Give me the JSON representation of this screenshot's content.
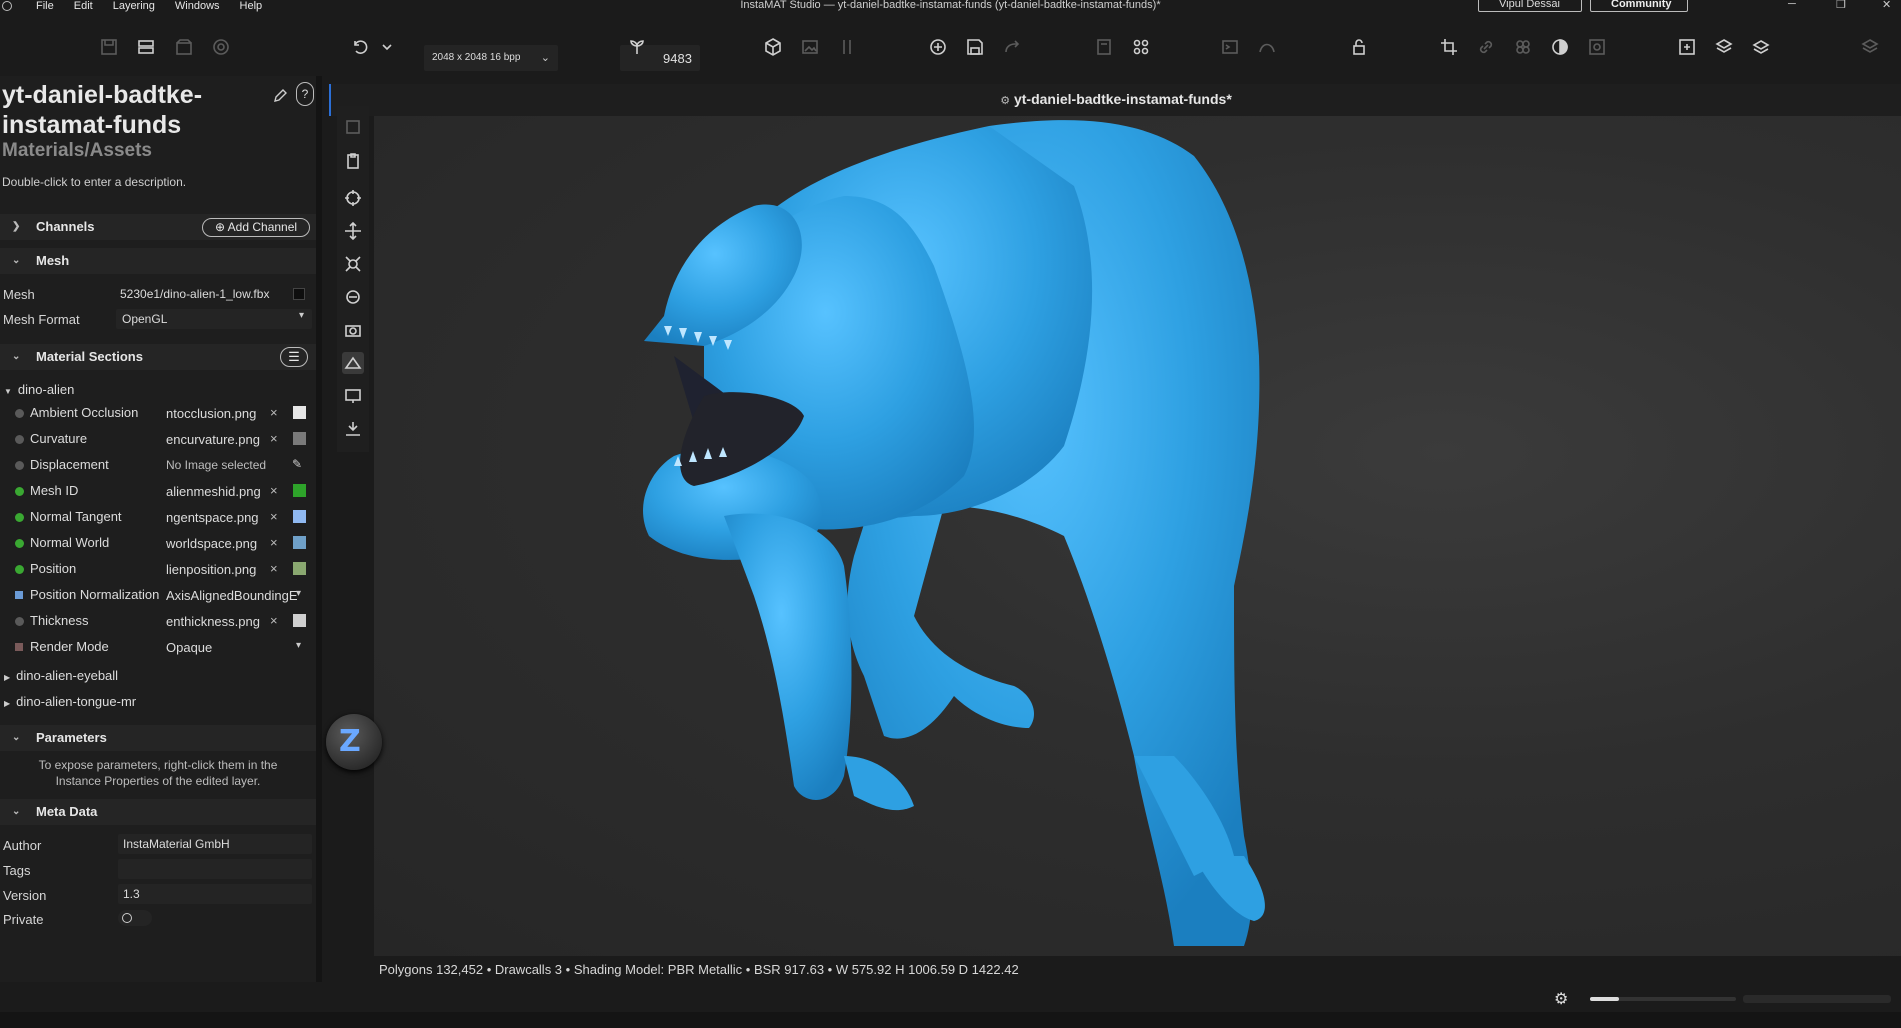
{
  "window": {
    "title": "InstaMAT Studio — yt-daniel-badtke-instamat-funds (yt-daniel-badtke-instamat-funds)*",
    "user_label": "Vipul Dessai",
    "community_label": "Community"
  },
  "menu": [
    "File",
    "Edit",
    "Layering",
    "Windows",
    "Help"
  ],
  "toolbar": {
    "resolution": "2048 x 2048 16 bpp",
    "seed": "9483"
  },
  "asset": {
    "title": "yt-daniel-badtke-instamat-funds",
    "subtitle": "Materials/Assets",
    "description": "Double-click to enter a description.",
    "help": "?"
  },
  "channels": {
    "label": "Channels",
    "add_label": "Add Channel"
  },
  "mesh": {
    "label": "Mesh",
    "mesh_label": "Mesh",
    "mesh_value": "5230e1/dino-alien-1_low.fbx",
    "format_label": "Mesh Format",
    "format_value": "OpenGL"
  },
  "material_sections": {
    "label": "Material Sections",
    "group": "dino-alien",
    "rows": [
      {
        "name": "Ambient Occlusion",
        "file": "ntocclusion.png",
        "x": "×",
        "dot": "#5a5a5a",
        "swatch": "#e6e6e6"
      },
      {
        "name": "Curvature",
        "file": "encurvature.png",
        "x": "×",
        "dot": "#5a5a5a",
        "swatch": "#7a7a7a"
      },
      {
        "name": "Displacement",
        "file": "No Image selected",
        "x": "",
        "dot": "#5a5a5a",
        "swatch": ""
      },
      {
        "name": "Mesh ID",
        "file": "alienmeshid.png",
        "x": "×",
        "dot": "#3aa832",
        "swatch": "#2ea32a"
      },
      {
        "name": "Normal Tangent",
        "file": "ngentspace.png",
        "x": "×",
        "dot": "#3aa832",
        "swatch": "#8fb8f0"
      },
      {
        "name": "Normal World",
        "file": "worldspace.png",
        "x": "×",
        "dot": "#3aa832",
        "swatch": "#6fa0c8"
      },
      {
        "name": "Position",
        "file": "lienposition.png",
        "x": "×",
        "dot": "#3aa832",
        "swatch": "#8aa870"
      },
      {
        "name": "Position Normalization",
        "file": "AxisAlignedBoundingE",
        "x": "",
        "dot": "#6b9bd6",
        "swatch": ""
      },
      {
        "name": "Thickness",
        "file": "enthickness.png",
        "x": "×",
        "dot": "#5a5a5a",
        "swatch": "#cfcfcf"
      },
      {
        "name": "Render Mode",
        "file": "Opaque",
        "x": "",
        "dot": "#7a5a5a",
        "swatch": ""
      }
    ],
    "others": [
      "dino-alien-eyeball",
      "dino-alien-tongue-mr"
    ]
  },
  "parameters": {
    "label": "Parameters",
    "hint_line1": "To expose parameters, right-click them in the",
    "hint_line2": "Instance Properties of the edited layer."
  },
  "meta": {
    "label": "Meta Data",
    "author_label": "Author",
    "author_value": "InstaMaterial GmbH",
    "tags_label": "Tags",
    "version_label": "Version",
    "version_value": "1.3",
    "private_label": "Private"
  },
  "viewport": {
    "title": "yt-daniel-badtke-instamat-funds*",
    "status": "Polygons 132,452 • Drawcalls 3 • Shading Model: PBR Metallic • BSR 917.63 • W 575.92 H 1006.59 D 1422.42",
    "model_color": "#35a6e6",
    "progress": 0.2
  }
}
